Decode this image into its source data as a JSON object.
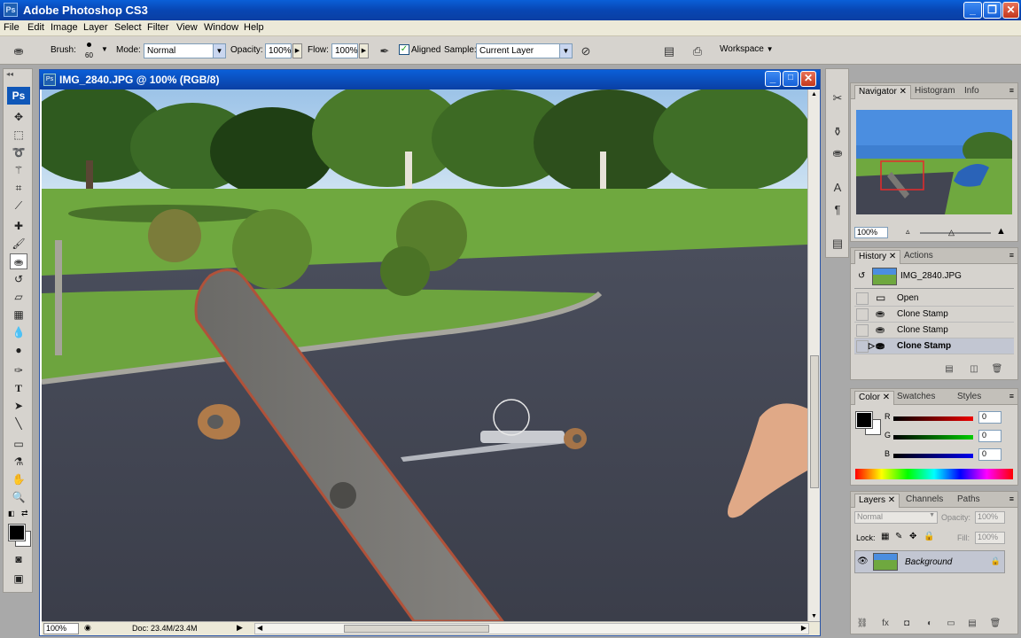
{
  "app": {
    "title": "Adobe Photoshop CS3",
    "icon_text": "Ps"
  },
  "menu": [
    "File",
    "Edit",
    "Image",
    "Layer",
    "Select",
    "Filter",
    "View",
    "Window",
    "Help"
  ],
  "options": {
    "brush_label": "Brush:",
    "brush_size": "60",
    "mode_label": "Mode:",
    "mode_value": "Normal",
    "opacity_label": "Opacity:",
    "opacity_value": "100%",
    "flow_label": "Flow:",
    "flow_value": "100%",
    "aligned_label": "Aligned",
    "aligned_checked": true,
    "sample_label": "Sample:",
    "sample_value": "Current Layer",
    "workspace_label": "Workspace"
  },
  "toolbox": {
    "ps_logo": "Ps"
  },
  "document": {
    "title": "IMG_2840.JPG @ 100% (RGB/8)",
    "icon_text": "Ps",
    "status_zoom": "100%",
    "status_doc": "Doc: 23.4M/23.4M"
  },
  "navigator": {
    "tabs": [
      "Navigator",
      "Histogram",
      "Info"
    ],
    "zoom": "100%"
  },
  "history": {
    "tabs": [
      "History",
      "Actions"
    ],
    "snapshot": "IMG_2840.JPG",
    "items": [
      "Open",
      "Clone Stamp",
      "Clone Stamp",
      "Clone Stamp"
    ],
    "selected_index": 3
  },
  "color": {
    "tabs": [
      "Color",
      "Swatches",
      "Styles"
    ],
    "r_label": "R",
    "g_label": "G",
    "b_label": "B",
    "r": "0",
    "g": "0",
    "b": "0"
  },
  "layers": {
    "tabs": [
      "Layers",
      "Channels",
      "Paths"
    ],
    "blend_mode": "Normal",
    "opacity_label": "Opacity:",
    "opacity_value": "100%",
    "lock_label": "Lock:",
    "fill_label": "Fill:",
    "fill_value": "100%",
    "items": [
      "Background"
    ]
  },
  "colors": {
    "titlebar": "#0a4fc8",
    "panel": "#d6d3ce",
    "menu": "#ece9d8"
  }
}
